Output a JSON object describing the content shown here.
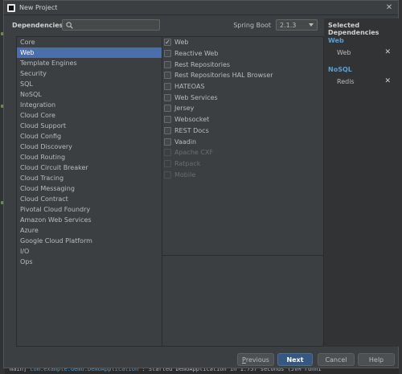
{
  "ide": {
    "console_thread": "main]",
    "console_class": "com.example.demo.DemoApplication",
    "console_message": ": Started DemoApplication in 1.757 seconds (JVM runni"
  },
  "window": {
    "title": "New Project"
  },
  "header": {
    "dependencies_label": "Dependencies",
    "search_placeholder": "",
    "spring_boot_label": "Spring Boot",
    "spring_boot_version": "2.1.3"
  },
  "categories": [
    {
      "label": "Core",
      "selected": false
    },
    {
      "label": "Web",
      "selected": true
    },
    {
      "label": "Template Engines",
      "selected": false
    },
    {
      "label": "Security",
      "selected": false
    },
    {
      "label": "SQL",
      "selected": false
    },
    {
      "label": "NoSQL",
      "selected": false
    },
    {
      "label": "Integration",
      "selected": false
    },
    {
      "label": "Cloud Core",
      "selected": false
    },
    {
      "label": "Cloud Support",
      "selected": false
    },
    {
      "label": "Cloud Config",
      "selected": false
    },
    {
      "label": "Cloud Discovery",
      "selected": false
    },
    {
      "label": "Cloud Routing",
      "selected": false
    },
    {
      "label": "Cloud Circuit Breaker",
      "selected": false
    },
    {
      "label": "Cloud Tracing",
      "selected": false
    },
    {
      "label": "Cloud Messaging",
      "selected": false
    },
    {
      "label": "Cloud Contract",
      "selected": false
    },
    {
      "label": "Pivotal Cloud Foundry",
      "selected": false
    },
    {
      "label": "Amazon Web Services",
      "selected": false
    },
    {
      "label": "Azure",
      "selected": false
    },
    {
      "label": "Google Cloud Platform",
      "selected": false
    },
    {
      "label": "I/O",
      "selected": false
    },
    {
      "label": "Ops",
      "selected": false
    }
  ],
  "dependencies": [
    {
      "label": "Web",
      "checked": true,
      "disabled": false
    },
    {
      "label": "Reactive Web",
      "checked": false,
      "disabled": false
    },
    {
      "label": "Rest Repositories",
      "checked": false,
      "disabled": false
    },
    {
      "label": "Rest Repositories HAL Browser",
      "checked": false,
      "disabled": false
    },
    {
      "label": "HATEOAS",
      "checked": false,
      "disabled": false
    },
    {
      "label": "Web Services",
      "checked": false,
      "disabled": false
    },
    {
      "label": "Jersey",
      "checked": false,
      "disabled": false
    },
    {
      "label": "Websocket",
      "checked": false,
      "disabled": false
    },
    {
      "label": "REST Docs",
      "checked": false,
      "disabled": false
    },
    {
      "label": "Vaadin",
      "checked": false,
      "disabled": false
    },
    {
      "label": "Apache CXF",
      "checked": false,
      "disabled": true
    },
    {
      "label": "Ratpack",
      "checked": false,
      "disabled": true
    },
    {
      "label": "Mobile",
      "checked": false,
      "disabled": true
    }
  ],
  "selected_panel": {
    "title": "Selected Dependencies",
    "groups": [
      {
        "name": "Web",
        "items": [
          "Web"
        ]
      },
      {
        "name": "NoSQL",
        "items": [
          "Redis"
        ]
      }
    ]
  },
  "buttons": {
    "previous_prefix": "",
    "previous_mnemonic": "P",
    "previous_rest": "revious",
    "next": "Next",
    "cancel": "Cancel",
    "help": "Help"
  },
  "colors": {
    "selection": "#4b6eaf",
    "group_title": "#5a9fd4",
    "default_button": "#365880"
  },
  "icons": {
    "search": "search-icon",
    "close": "close-icon",
    "remove": "remove-icon",
    "check": "checkmark-icon",
    "dropdown": "chevron-down-icon"
  }
}
